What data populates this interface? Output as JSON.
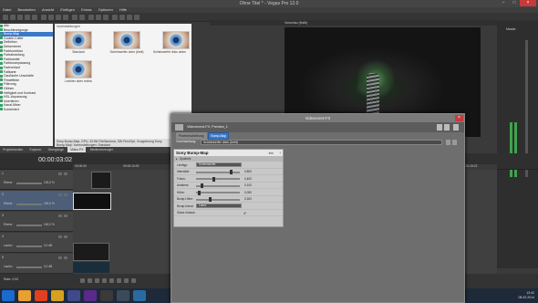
{
  "window": {
    "title": "Ohne Titel * - Vegas Pro 12.0"
  },
  "menu": [
    "Datei",
    "Bearbeiten",
    "Ansicht",
    "Einfügen",
    "Extras",
    "Optionen",
    "Hilfe"
  ],
  "explorer": {
    "items": [
      "Alle",
      "Beschleunigungs",
      "Bump-Map",
      "Cookie-Cutter",
      "Definition",
      "Deformieren",
      "Farbkorrektur",
      "Farbabstufung",
      "Farbkanäle",
      "Farbtonanpassung",
      "Farbverlauf",
      "Faltkarte",
      "Gaußsche Unschärfe",
      "Filmeffekte",
      "Filterung",
      "Glühen",
      "Helligkeit und Kontrast",
      "HSL-Anpassung",
      "Invertieren",
      "Kanal-Mixer",
      "Kombiniert"
    ],
    "selected_index": 2
  },
  "fx_pane": {
    "header": "Voreinstellungen",
    "presets": [
      "Standard",
      "Scheinwerfer oben (breit)",
      "Scheinwerfer links unten",
      "Leichter oben rechts"
    ],
    "status": "Sony Bump-Map: GPU, 32-Bit Fließkomma, 32b Flex/Opt, Gruppierung Sony Bump-Map: Voreinstellungen: Standard"
  },
  "tabs": [
    {
      "label": "Projektmedien",
      "active": false
    },
    {
      "label": "Explorer",
      "active": false
    },
    {
      "label": "Übergänge",
      "active": false
    },
    {
      "label": "Video FX",
      "active": true
    },
    {
      "label": "Medienerzeuger",
      "active": false
    }
  ],
  "preview": {
    "quality": "Vorschau (Halb)"
  },
  "mixer": {
    "title": "Master"
  },
  "timeline": {
    "timecode": "00:00:03:02",
    "ruler_marks": [
      "00:00:00",
      "00:00:10:00",
      "00:00:19:23",
      "00:00:29:23",
      "00:00:39:23",
      "00:00:49:23",
      "00:00:59:22",
      "00:01:09:22",
      "00:01:19:22"
    ],
    "tracks": [
      {
        "num": "1",
        "level_label": "Ebene:",
        "level_value": "100,0 %"
      },
      {
        "num": "2",
        "level_label": "Ebene:",
        "level_value": "100,0 %"
      },
      {
        "num": "3",
        "level_label": "Ebene:",
        "level_value": "100,0 %"
      },
      {
        "num": "4",
        "level_label": "Lautst.:",
        "level_value": "0,0 dB"
      },
      {
        "num": "5",
        "level_label": "Lautst.:",
        "level_value": "0,0 dB"
      }
    ]
  },
  "bottom": {
    "rate": "Rate: 0,00"
  },
  "dialog": {
    "title": "Videoevent-FX",
    "fx_title": "Videoevent-FX: Preview_1",
    "chain": [
      "Pixelverschiebung",
      "Bump-Map"
    ],
    "chain_active_index": 1,
    "preset_label": "Voreinstellung:",
    "preset_value": "Scheinwerfer oben (breit)",
    "panel_title": "Sony Bump-Map",
    "panel_info": "Info",
    "panel_help": "?",
    "section": "Spotlicht",
    "params": [
      {
        "label": "Lichttyp:",
        "type": "dropdown",
        "value": "Scheinwerfer"
      },
      {
        "label": "Intensität:",
        "type": "slider",
        "value": "0,800",
        "pos": 0.8
      },
      {
        "label": "Fokus:",
        "type": "slider",
        "value": "0,400",
        "pos": 0.4
      },
      {
        "label": "Ambienz:",
        "type": "slider",
        "value": "0,100",
        "pos": 0.1
      },
      {
        "label": "Höhe:",
        "type": "slider",
        "value": "0,050",
        "pos": 0.05
      },
      {
        "label": "Bump-Höhe:",
        "type": "slider",
        "value": "0,300",
        "pos": 0.3
      },
      {
        "label": "Bump-Kanal:",
        "type": "dropdown",
        "value": "Luma"
      },
      {
        "label": "Glanz ein/aus:",
        "type": "check",
        "value": "✔"
      }
    ]
  },
  "taskbar": {
    "time": "13:42",
    "date": "08.02.2014"
  }
}
